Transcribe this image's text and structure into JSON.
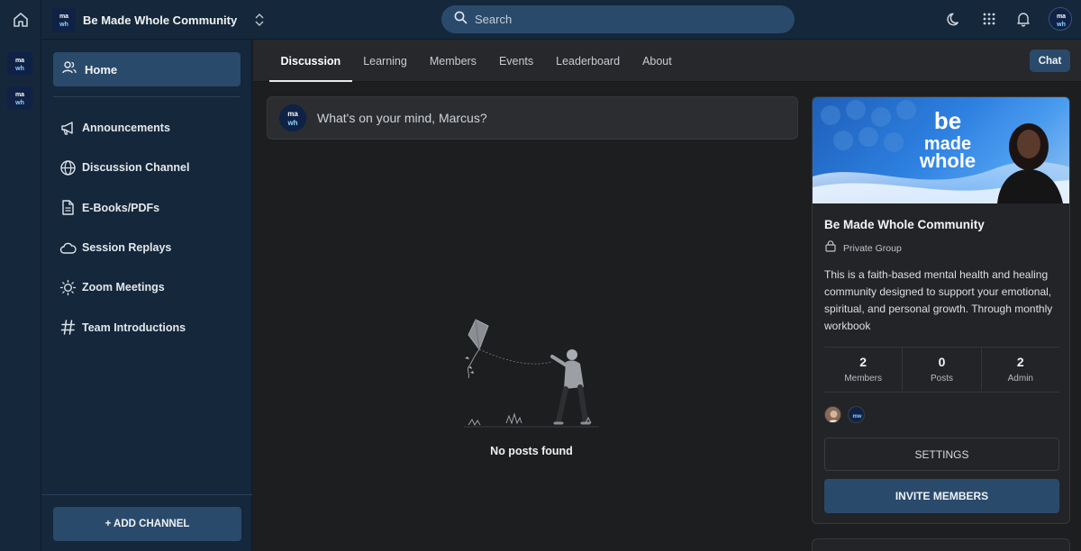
{
  "community": {
    "name": "Be Made Whole Community",
    "logo_text": "be made whole"
  },
  "search": {
    "placeholder": "Search"
  },
  "sidebar": {
    "home_label": "Home",
    "items": [
      {
        "label": "Announcements",
        "icon": "megaphone-icon"
      },
      {
        "label": "Discussion Channel",
        "icon": "globe-icon"
      },
      {
        "label": "E-Books/PDFs",
        "icon": "document-icon"
      },
      {
        "label": "Session Replays",
        "icon": "cloud-icon"
      },
      {
        "label": "Zoom Meetings",
        "icon": "lightbulb-icon"
      },
      {
        "label": "Team Introductions",
        "icon": "hashtag-icon"
      }
    ],
    "add_channel_label": "+ ADD CHANNEL"
  },
  "tabs": [
    {
      "label": "Discussion",
      "active": true
    },
    {
      "label": "Learning"
    },
    {
      "label": "Members"
    },
    {
      "label": "Events"
    },
    {
      "label": "Leaderboard"
    },
    {
      "label": "About"
    }
  ],
  "chat_label": "Chat",
  "composer": {
    "placeholder": "What's on your mind, Marcus?"
  },
  "empty_state": {
    "message": "No posts found"
  },
  "card": {
    "title": "Be Made Whole Community",
    "privacy": "Private Group",
    "description": "This is a faith-based mental health and healing community designed to support your emotional, spiritual, and personal growth. Through monthly workbook",
    "stats": [
      {
        "value": "2",
        "label": "Members"
      },
      {
        "value": "0",
        "label": "Posts"
      },
      {
        "value": "2",
        "label": "Admin"
      }
    ],
    "settings_label": "SETTINGS",
    "invite_label": "INVITE MEMBERS"
  },
  "colors": {
    "accent": "#2a4a6b",
    "sidebar_bg": "#15273a",
    "content_bg": "#1d1e20"
  }
}
